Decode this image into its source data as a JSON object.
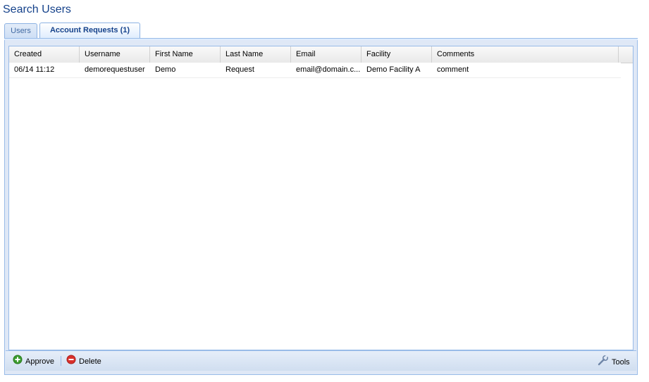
{
  "page": {
    "title": "Search Users"
  },
  "tabs": [
    {
      "label": "Users"
    },
    {
      "label": "Account Requests (1)"
    }
  ],
  "grid": {
    "columns": [
      "Created",
      "Username",
      "First Name",
      "Last Name",
      "Email",
      "Facility",
      "Comments"
    ],
    "rows": [
      [
        "06/14 11:12",
        "demorequestuser",
        "Demo",
        "Request",
        "email@domain.c...",
        "Demo Facility A",
        "comment"
      ]
    ]
  },
  "toolbar": {
    "approve_label": "Approve",
    "delete_label": "Delete",
    "tools_label": "Tools"
  },
  "colors": {
    "title": "#15428b",
    "border": "#99bbe8",
    "approve": "#3a9b2e",
    "delete": "#d9302c"
  },
  "icons": {
    "approve": "add-circle-icon",
    "delete": "remove-circle-icon",
    "tools": "wrench-icon"
  }
}
